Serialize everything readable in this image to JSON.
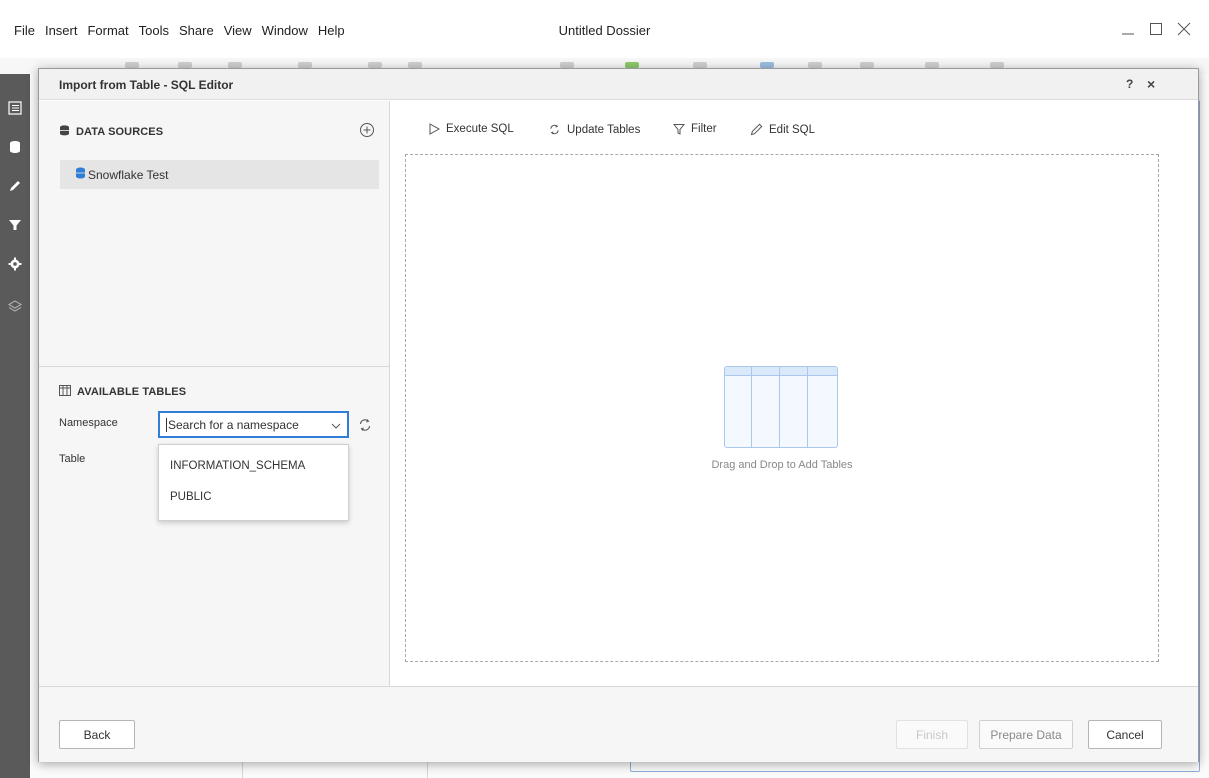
{
  "app": {
    "title": "Untitled Dossier",
    "menus": [
      "File",
      "Insert",
      "Format",
      "Tools",
      "Share",
      "View",
      "Window",
      "Help"
    ]
  },
  "dialog": {
    "title": "Import from Table - SQL Editor",
    "help_label": "?",
    "close_label": "×"
  },
  "data_sources": {
    "heading": "DATA SOURCES",
    "items": [
      {
        "label": "Snowflake Test"
      }
    ]
  },
  "available_tables": {
    "heading": "AVAILABLE TABLES",
    "namespace_label": "Namespace",
    "namespace_placeholder": "Search for a namespace",
    "table_label": "Table",
    "namespace_options": [
      "INFORMATION_SCHEMA",
      "PUBLIC"
    ]
  },
  "toolbar": {
    "execute": "Execute SQL",
    "update": "Update Tables",
    "filter": "Filter",
    "edit": "Edit SQL"
  },
  "canvas": {
    "hint": "Drag and Drop to Add Tables"
  },
  "footer": {
    "back": "Back",
    "finish": "Finish",
    "prepare": "Prepare Data",
    "cancel": "Cancel"
  },
  "colors": {
    "accent": "#2f7fd6",
    "db_icon": "#2f7fd6"
  }
}
